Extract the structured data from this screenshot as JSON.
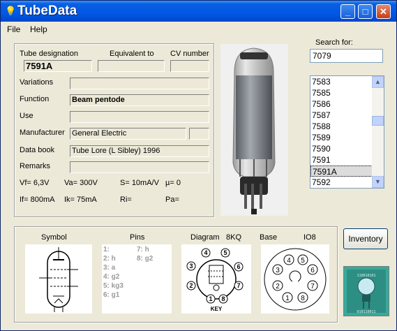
{
  "window": {
    "title": "TubeData",
    "minimize": "_",
    "maximize": "□",
    "close": "✕"
  },
  "menu": {
    "file": "File",
    "help": "Help"
  },
  "main": {
    "tube_designation_label": "Tube designation",
    "equivalent_label": "Equivalent to",
    "cv_label": "CV number",
    "tube_designation": "7591A",
    "equivalent": "",
    "cv_number": "",
    "variations_label": "Variations",
    "variations": "",
    "function_label": "Function",
    "function": "Beam pentode",
    "use_label": "Use",
    "use": "",
    "manufacturer_label": "Manufacturer",
    "manufacturer": "General Electric",
    "manufacturer_code": "",
    "databook_label": "Data book",
    "databook": "Tube Lore (L Sibley) 1996",
    "remarks_label": "Remarks",
    "remarks": "",
    "params_row1": {
      "vf": "Vf= 6,3V",
      "va": "Va=  300V",
      "s": "S= 10mA/V",
      "mu": "µ=    0"
    },
    "params_row2": {
      "if": "If= 800mA",
      "ik": "Ik=  75mA",
      "ri": "Ri=",
      "pa": "Pa="
    }
  },
  "search": {
    "label": "Search for:",
    "value": "7079",
    "items": [
      "7583",
      "7585",
      "7586",
      "7587",
      "7588",
      "7589",
      "7590",
      "7591",
      "7591A",
      "7592"
    ],
    "selected_index": 8
  },
  "bottom": {
    "symbol_label": "Symbol",
    "pins_label": "Pins",
    "diagram_label": "Diagram",
    "diagram_code": "8KQ",
    "base_label": "Base",
    "base_code": "IO8",
    "pins_left": [
      "1:",
      "2: h",
      "3: a",
      "4: g2",
      "5: kg3",
      "6: g1"
    ],
    "pins_right": [
      "7: h",
      "8: g2"
    ],
    "key_label": "KEY",
    "diagram_pins": [
      "1",
      "2",
      "3",
      "4",
      "5",
      "6",
      "7",
      "8"
    ],
    "base_pins": [
      "1",
      "2",
      "3",
      "4",
      "5",
      "6",
      "7",
      "8"
    ]
  },
  "inventory_button": "Inventory"
}
